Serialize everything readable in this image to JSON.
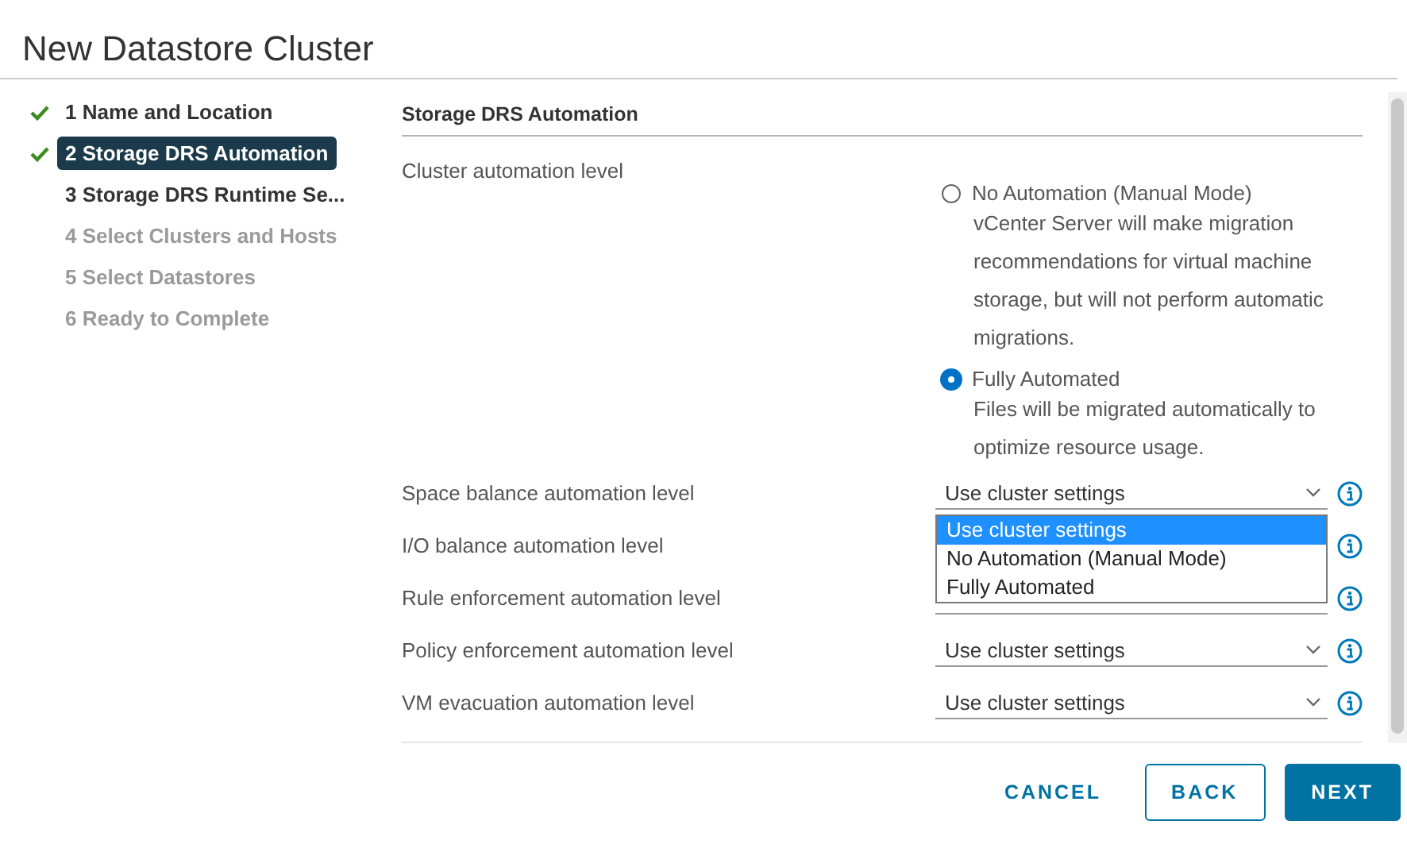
{
  "window": {
    "title": "New Datastore Cluster"
  },
  "steps": [
    {
      "label": "1 Name and Location",
      "checked": true,
      "selected": false,
      "disabled": false
    },
    {
      "label": "2 Storage DRS Automation",
      "checked": true,
      "selected": true,
      "disabled": false
    },
    {
      "label": "3 Storage DRS Runtime Se...",
      "checked": false,
      "selected": false,
      "disabled": false
    },
    {
      "label": "4 Select Clusters and Hosts",
      "checked": false,
      "selected": false,
      "disabled": true
    },
    {
      "label": "5 Select Datastores",
      "checked": false,
      "selected": false,
      "disabled": true
    },
    {
      "label": "6 Ready to Complete",
      "checked": false,
      "selected": false,
      "disabled": true
    }
  ],
  "section": {
    "title": "Storage DRS Automation"
  },
  "cluster_automation": {
    "label": "Cluster automation level",
    "options": [
      {
        "label": "No Automation (Manual Mode)",
        "description": "vCenter Server will make migration recommendations for virtual machine storage, but will not perform automatic migrations.",
        "selected": false
      },
      {
        "label": "Fully Automated",
        "description": "Files will be migrated automatically to optimize resource usage.",
        "selected": true
      }
    ]
  },
  "settings": [
    {
      "label": "Space balance automation level",
      "value": "Use cluster settings",
      "open_options": [
        {
          "label": "Use cluster settings",
          "selected": true
        },
        {
          "label": "No Automation (Manual Mode)",
          "selected": false
        },
        {
          "label": "Fully Automated",
          "selected": false
        }
      ]
    },
    {
      "label": "I/O balance automation level"
    },
    {
      "label": "Rule enforcement automation level"
    },
    {
      "label": "Policy enforcement automation level",
      "value": "Use cluster settings"
    },
    {
      "label": "VM evacuation automation level",
      "value": "Use cluster settings"
    }
  ],
  "buttons": [
    {
      "label": "CANCEL",
      "kind": "flat"
    },
    {
      "label": "BACK",
      "kind": "outline"
    },
    {
      "label": "NEXT",
      "kind": "primary"
    }
  ]
}
